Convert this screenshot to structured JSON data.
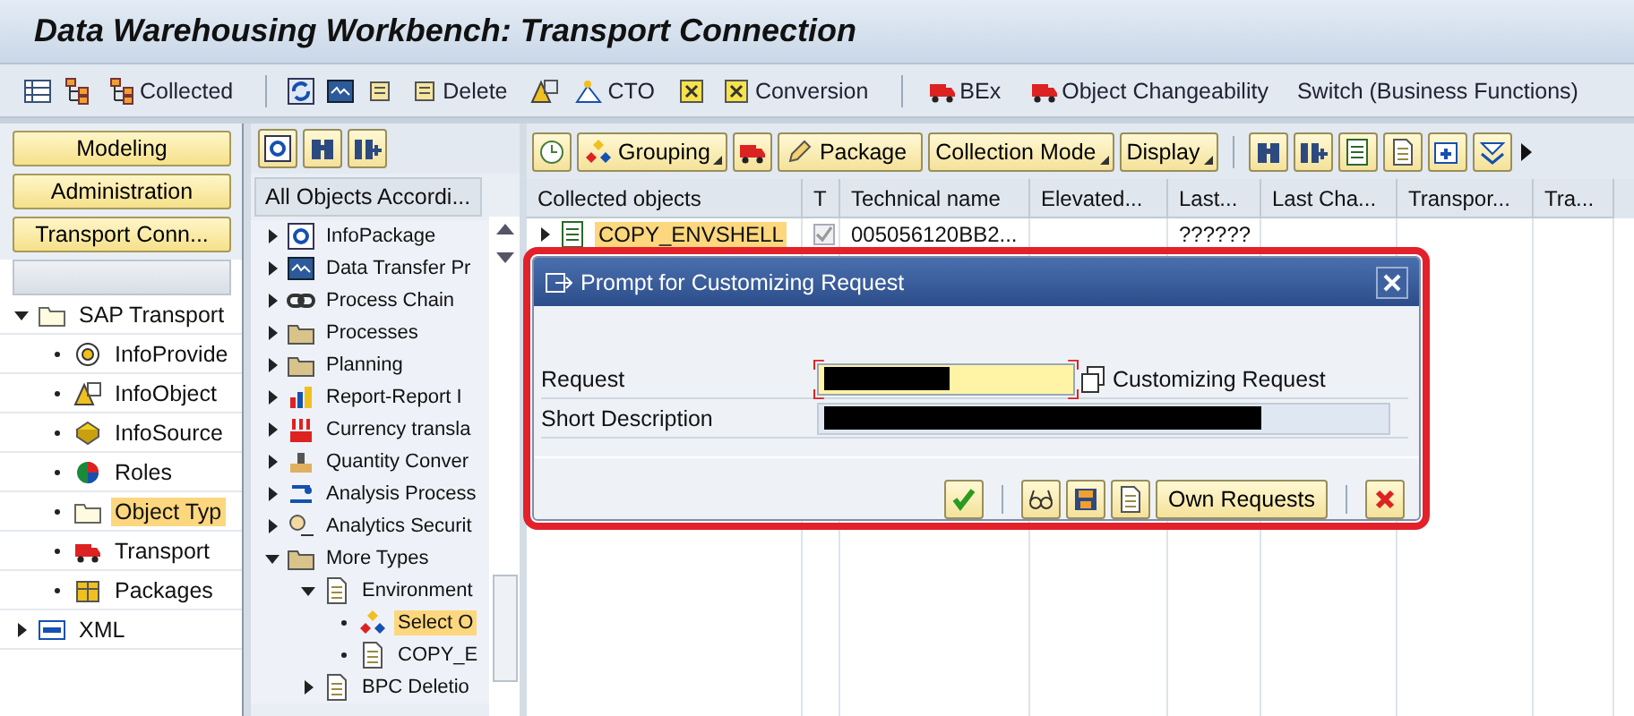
{
  "window": {
    "title": "Data Warehousing Workbench: Transport Connection"
  },
  "toolbar": [
    {
      "kind": "icon"
    },
    {
      "kind": "icon"
    },
    {
      "kind": "labeled",
      "label": "Collected"
    },
    {
      "kind": "separator"
    },
    {
      "kind": "icon"
    },
    {
      "kind": "icon"
    },
    {
      "kind": "icon"
    },
    {
      "kind": "labeled",
      "label": "Delete"
    },
    {
      "kind": "icon"
    },
    {
      "kind": "labeled",
      "label": "CTO"
    },
    {
      "kind": "icon"
    },
    {
      "kind": "labeled",
      "label": "Conversion"
    },
    {
      "kind": "separator"
    },
    {
      "kind": "labeled",
      "label": "BEx"
    },
    {
      "kind": "labeled",
      "label": "Object Changeability"
    },
    {
      "kind": "text",
      "label": "Switch (Business Functions)"
    }
  ],
  "navigation": {
    "buttons": [
      "Modeling",
      "Administration",
      "Transport Conn..."
    ],
    "tree": [
      {
        "label": "SAP Transport",
        "expanded": true,
        "selected": false,
        "children": [
          {
            "label": "InfoProvide",
            "selected": false
          },
          {
            "label": "InfoObject",
            "selected": false
          },
          {
            "label": "InfoSource",
            "selected": false
          },
          {
            "label": "Roles",
            "selected": false
          },
          {
            "label": "Object Typ",
            "selected": true
          },
          {
            "label": "Transport",
            "selected": false
          },
          {
            "label": "Packages",
            "selected": false
          }
        ]
      },
      {
        "label": "XML",
        "expanded": false,
        "selected": false
      }
    ]
  },
  "object_types": {
    "header": "All Objects Accordi...",
    "tree": [
      {
        "label": "InfoPackage",
        "expanded": false,
        "selected": false
      },
      {
        "label": "Data Transfer Pr",
        "expanded": false,
        "selected": false
      },
      {
        "label": "Process Chain",
        "expanded": false,
        "selected": false
      },
      {
        "label": "Processes",
        "expanded": false,
        "selected": false
      },
      {
        "label": "Planning",
        "expanded": false,
        "selected": false
      },
      {
        "label": "Report-Report I",
        "expanded": false,
        "selected": false
      },
      {
        "label": "Currency transla",
        "expanded": false,
        "selected": false
      },
      {
        "label": "Quantity Conver",
        "expanded": false,
        "selected": false
      },
      {
        "label": "Analysis Process",
        "expanded": false,
        "selected": false
      },
      {
        "label": "Analytics Securit",
        "expanded": false,
        "selected": false
      },
      {
        "label": "More Types",
        "expanded": true,
        "selected": false,
        "children": [
          {
            "label": "Environment",
            "expanded": true,
            "selected": false,
            "children": [
              {
                "label": "Select O",
                "selected": true
              },
              {
                "label": "COPY_E",
                "selected": false
              }
            ]
          },
          {
            "label": "BPC Deletio",
            "expanded": false,
            "selected": false
          }
        ]
      }
    ]
  },
  "collection": {
    "toolbar": [
      {
        "kind": "icon"
      },
      {
        "kind": "menu",
        "label": "Grouping"
      },
      {
        "kind": "icon"
      },
      {
        "kind": "labeled",
        "label": "Package"
      },
      {
        "kind": "menu",
        "label": "Collection Mode"
      },
      {
        "kind": "menu",
        "label": "Display"
      },
      {
        "kind": "separator"
      },
      {
        "kind": "icon"
      },
      {
        "kind": "icon"
      },
      {
        "kind": "icon"
      },
      {
        "kind": "icon"
      },
      {
        "kind": "icon"
      },
      {
        "kind": "icon"
      },
      {
        "kind": "more"
      }
    ],
    "columns": [
      "Collected objects",
      "T",
      "Technical name",
      "Elevated...",
      "Last...",
      "Last Cha...",
      "Transpor...",
      "Tra..."
    ],
    "rows": [
      {
        "object": "COPY_ENVSHELL",
        "expanded": false,
        "selected": true,
        "checked": true,
        "disabled": true,
        "technical_name": "005056120BB2...",
        "last": "??????"
      }
    ]
  },
  "dialog": {
    "title": "Prompt for Customizing Request",
    "highlighted": true,
    "fields": [
      {
        "label": "Request",
        "editable": true,
        "focused": true,
        "redacted": true,
        "suffix": "Customizing Request"
      },
      {
        "label": "Short Description",
        "editable": false,
        "focused": false,
        "redacted": true
      }
    ],
    "buttons": [
      {
        "kind": "icon"
      },
      {
        "kind": "separator"
      },
      {
        "kind": "icon"
      },
      {
        "kind": "icon"
      },
      {
        "kind": "icon"
      },
      {
        "kind": "text",
        "label": "Own Requests"
      },
      {
        "kind": "separator"
      },
      {
        "kind": "icon"
      }
    ]
  }
}
